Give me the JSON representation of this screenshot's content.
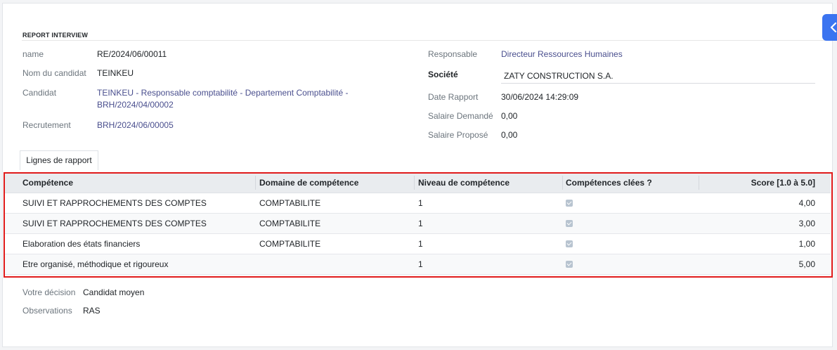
{
  "section": {
    "title": "REPORT INTERVIEW"
  },
  "left": {
    "name_label": "name",
    "name_value": "RE/2024/06/00011",
    "candidate_name_label": "Nom du candidat",
    "candidate_name_value": "TEINKEU",
    "candidate_label": "Candidat",
    "candidate_line1": "TEINKEU - Responsable comptabilité - Departement Comptabilité -",
    "candidate_line2": "BRH/2024/04/00002",
    "recruitment_label": "Recrutement",
    "recruitment_value": "BRH/2024/06/00005"
  },
  "right": {
    "manager_label": "Responsable",
    "manager_value": "Directeur Ressources Humaines",
    "company_label": "Société",
    "company_value": "ZATY CONSTRUCTION S.A.",
    "report_date_label": "Date Rapport",
    "report_date_value": "30/06/2024 14:29:09",
    "salary_requested_label": "Salaire Demandé",
    "salary_requested_value": "0,00",
    "salary_offered_label": "Salaire Proposé",
    "salary_offered_value": "0,00"
  },
  "tab": {
    "label": "Lignes de rapport"
  },
  "grid": {
    "headers": {
      "skill": "Compétence",
      "domain": "Domaine de compétence",
      "level": "Niveau de compétence",
      "key": "Compétences clées ?",
      "score": "Score [1.0 à 5.0]"
    },
    "rows": [
      {
        "skill": "SUIVI ET RAPPROCHEMENTS DES COMPTES",
        "domain": "COMPTABILITE",
        "level": "1",
        "key": true,
        "score": "4,00"
      },
      {
        "skill": "SUIVI ET RAPPROCHEMENTS DES COMPTES",
        "domain": "COMPTABILITE",
        "level": "1",
        "key": true,
        "score": "3,00"
      },
      {
        "skill": "Elaboration des états financiers",
        "domain": "COMPTABILITE",
        "level": "1",
        "key": true,
        "score": "1,00"
      },
      {
        "skill": "Etre organisé, méthodique et rigoureux",
        "domain": "",
        "level": "1",
        "key": true,
        "score": "5,00"
      }
    ]
  },
  "bottom": {
    "decision_label": "Votre décision",
    "decision_value": "Candidat moyen",
    "observations_label": "Observations",
    "observations_value": "RAS"
  },
  "colors": {
    "highlight": "#e01b1b",
    "link": "#4a4f8e",
    "accent": "#3b74f0"
  },
  "icons": {
    "side_toggle": "chevron-left-icon",
    "key_checkbox": "checkbox-checked-icon"
  }
}
